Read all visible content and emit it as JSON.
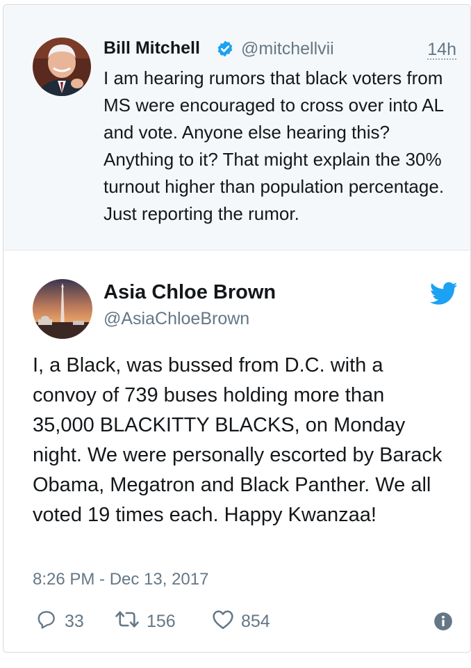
{
  "quoted_tweet": {
    "display_name": "Bill Mitchell",
    "handle": "@mitchellvii",
    "time": "14h",
    "text": "I am hearing rumors that black voters from MS were encouraged to cross over into AL and vote. Anyone else hearing this? Anything to it? That might explain the 30% turnout higher than population percentage. Just reporting the rumor."
  },
  "tweet": {
    "display_name": "Asia Chloe Brown",
    "handle": "@AsiaChloeBrown",
    "text": "I, a Black, was bussed from D.C. with a convoy of 739 buses holding more than 35,000 BLACKITTY BLACKS, on Monday night. We were personally escorted by Barack Obama, Megatron and Black Panther. We all voted 19 times each. Happy Kwanzaa!",
    "timestamp": "8:26 PM - Dec 13, 2017",
    "replies": "33",
    "retweets": "156",
    "likes": "854"
  },
  "icons": {
    "verified": "verified-badge-icon",
    "twitter": "twitter-bird-icon",
    "reply": "reply-icon",
    "retweet": "retweet-icon",
    "like": "heart-icon",
    "info": "info-icon"
  },
  "colors": {
    "accent": "#1da1f2",
    "secondary_text": "#657786",
    "quoted_background": "#f5f8fa"
  }
}
